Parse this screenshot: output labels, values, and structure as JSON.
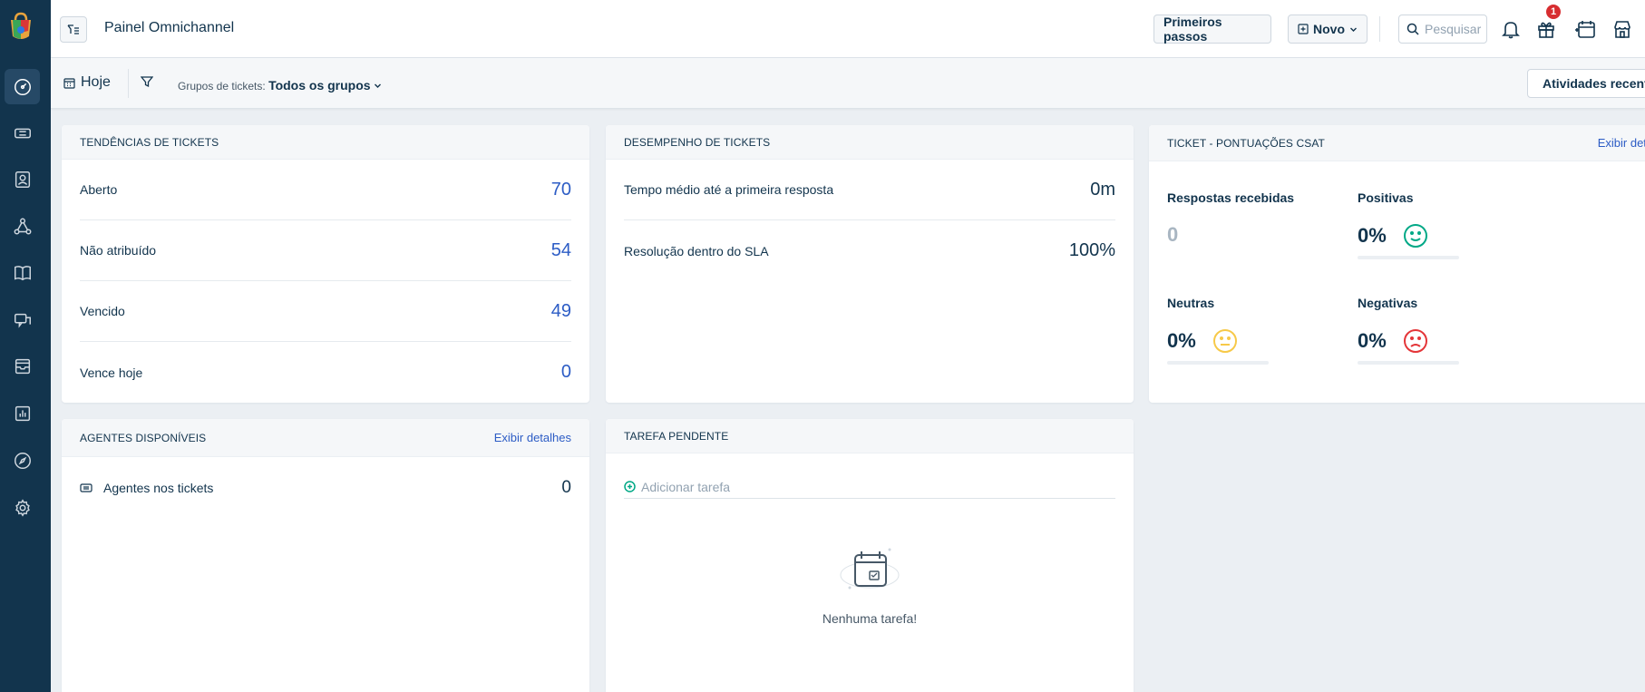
{
  "header": {
    "title": "Painel Omnichannel",
    "first_steps": "Primeiros passos",
    "new_label": "Novo",
    "search_placeholder": "Pesquisar",
    "gift_badge": "1"
  },
  "filterbar": {
    "today": "Hoje",
    "groups_label": "Grupos de tickets:",
    "groups_value": "Todos os grupos",
    "activities": "Atividades recentes"
  },
  "trends": {
    "title": "Tendências de tickets",
    "rows": [
      {
        "label": "Aberto",
        "value": "70"
      },
      {
        "label": "Não atribuído",
        "value": "54"
      },
      {
        "label": "Vencido",
        "value": "49"
      },
      {
        "label": "Vence hoje",
        "value": "0"
      }
    ]
  },
  "performance": {
    "title": "Desempenho de tickets",
    "rows": [
      {
        "label": "Tempo médio até a primeira resposta",
        "value": "0m"
      },
      {
        "label": "Resolução dentro do SLA",
        "value": "100%"
      }
    ]
  },
  "csat": {
    "title": "Ticket - pontuações CSAT",
    "link": "Exibir detalhes",
    "received_label": "Respostas recebidas",
    "received_value": "0",
    "positive_label": "Positivas",
    "positive_value": "0%",
    "neutral_label": "Neutras",
    "neutral_value": "0%",
    "negative_label": "Negativas",
    "negative_value": "0%",
    "colors": {
      "positive": "#00a886",
      "neutral": "#f7c948",
      "negative": "#e43538"
    }
  },
  "agents": {
    "title": "Agentes disponíveis",
    "link": "Exibir detalhes",
    "row_label": "Agentes nos tickets",
    "row_value": "0"
  },
  "tasks": {
    "title": "Tarefa pendente",
    "add_placeholder": "Adicionar tarefa",
    "empty": "Nenhuma tarefa!"
  }
}
